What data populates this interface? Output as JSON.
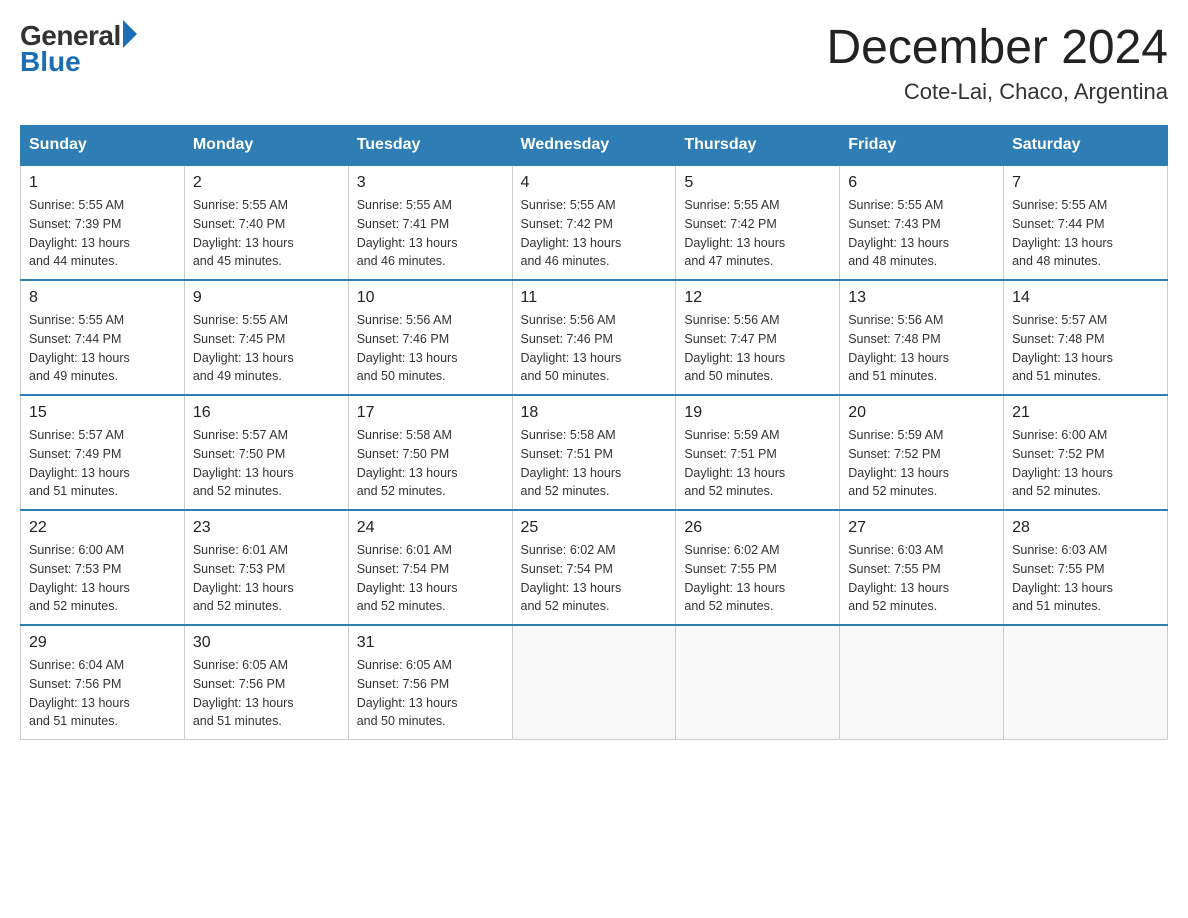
{
  "logo": {
    "general": "General",
    "blue": "Blue",
    "triangle_color": "#1a6eb5"
  },
  "header": {
    "month_year": "December 2024",
    "location": "Cote-Lai, Chaco, Argentina"
  },
  "weekdays": [
    "Sunday",
    "Monday",
    "Tuesday",
    "Wednesday",
    "Thursday",
    "Friday",
    "Saturday"
  ],
  "weeks": [
    [
      {
        "day": "1",
        "sunrise": "5:55 AM",
        "sunset": "7:39 PM",
        "daylight": "13 hours and 44 minutes."
      },
      {
        "day": "2",
        "sunrise": "5:55 AM",
        "sunset": "7:40 PM",
        "daylight": "13 hours and 45 minutes."
      },
      {
        "day": "3",
        "sunrise": "5:55 AM",
        "sunset": "7:41 PM",
        "daylight": "13 hours and 46 minutes."
      },
      {
        "day": "4",
        "sunrise": "5:55 AM",
        "sunset": "7:42 PM",
        "daylight": "13 hours and 46 minutes."
      },
      {
        "day": "5",
        "sunrise": "5:55 AM",
        "sunset": "7:42 PM",
        "daylight": "13 hours and 47 minutes."
      },
      {
        "day": "6",
        "sunrise": "5:55 AM",
        "sunset": "7:43 PM",
        "daylight": "13 hours and 48 minutes."
      },
      {
        "day": "7",
        "sunrise": "5:55 AM",
        "sunset": "7:44 PM",
        "daylight": "13 hours and 48 minutes."
      }
    ],
    [
      {
        "day": "8",
        "sunrise": "5:55 AM",
        "sunset": "7:44 PM",
        "daylight": "13 hours and 49 minutes."
      },
      {
        "day": "9",
        "sunrise": "5:55 AM",
        "sunset": "7:45 PM",
        "daylight": "13 hours and 49 minutes."
      },
      {
        "day": "10",
        "sunrise": "5:56 AM",
        "sunset": "7:46 PM",
        "daylight": "13 hours and 50 minutes."
      },
      {
        "day": "11",
        "sunrise": "5:56 AM",
        "sunset": "7:46 PM",
        "daylight": "13 hours and 50 minutes."
      },
      {
        "day": "12",
        "sunrise": "5:56 AM",
        "sunset": "7:47 PM",
        "daylight": "13 hours and 50 minutes."
      },
      {
        "day": "13",
        "sunrise": "5:56 AM",
        "sunset": "7:48 PM",
        "daylight": "13 hours and 51 minutes."
      },
      {
        "day": "14",
        "sunrise": "5:57 AM",
        "sunset": "7:48 PM",
        "daylight": "13 hours and 51 minutes."
      }
    ],
    [
      {
        "day": "15",
        "sunrise": "5:57 AM",
        "sunset": "7:49 PM",
        "daylight": "13 hours and 51 minutes."
      },
      {
        "day": "16",
        "sunrise": "5:57 AM",
        "sunset": "7:50 PM",
        "daylight": "13 hours and 52 minutes."
      },
      {
        "day": "17",
        "sunrise": "5:58 AM",
        "sunset": "7:50 PM",
        "daylight": "13 hours and 52 minutes."
      },
      {
        "day": "18",
        "sunrise": "5:58 AM",
        "sunset": "7:51 PM",
        "daylight": "13 hours and 52 minutes."
      },
      {
        "day": "19",
        "sunrise": "5:59 AM",
        "sunset": "7:51 PM",
        "daylight": "13 hours and 52 minutes."
      },
      {
        "day": "20",
        "sunrise": "5:59 AM",
        "sunset": "7:52 PM",
        "daylight": "13 hours and 52 minutes."
      },
      {
        "day": "21",
        "sunrise": "6:00 AM",
        "sunset": "7:52 PM",
        "daylight": "13 hours and 52 minutes."
      }
    ],
    [
      {
        "day": "22",
        "sunrise": "6:00 AM",
        "sunset": "7:53 PM",
        "daylight": "13 hours and 52 minutes."
      },
      {
        "day": "23",
        "sunrise": "6:01 AM",
        "sunset": "7:53 PM",
        "daylight": "13 hours and 52 minutes."
      },
      {
        "day": "24",
        "sunrise": "6:01 AM",
        "sunset": "7:54 PM",
        "daylight": "13 hours and 52 minutes."
      },
      {
        "day": "25",
        "sunrise": "6:02 AM",
        "sunset": "7:54 PM",
        "daylight": "13 hours and 52 minutes."
      },
      {
        "day": "26",
        "sunrise": "6:02 AM",
        "sunset": "7:55 PM",
        "daylight": "13 hours and 52 minutes."
      },
      {
        "day": "27",
        "sunrise": "6:03 AM",
        "sunset": "7:55 PM",
        "daylight": "13 hours and 52 minutes."
      },
      {
        "day": "28",
        "sunrise": "6:03 AM",
        "sunset": "7:55 PM",
        "daylight": "13 hours and 51 minutes."
      }
    ],
    [
      {
        "day": "29",
        "sunrise": "6:04 AM",
        "sunset": "7:56 PM",
        "daylight": "13 hours and 51 minutes."
      },
      {
        "day": "30",
        "sunrise": "6:05 AM",
        "sunset": "7:56 PM",
        "daylight": "13 hours and 51 minutes."
      },
      {
        "day": "31",
        "sunrise": "6:05 AM",
        "sunset": "7:56 PM",
        "daylight": "13 hours and 50 minutes."
      },
      null,
      null,
      null,
      null
    ]
  ],
  "labels": {
    "sunrise": "Sunrise:",
    "sunset": "Sunset:",
    "daylight": "Daylight:"
  }
}
